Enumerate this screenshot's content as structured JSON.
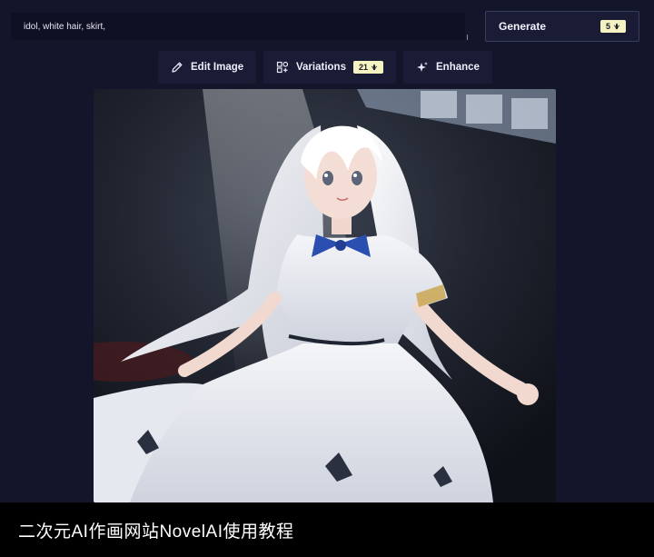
{
  "prompt": {
    "value": "idol, white hair, skirt,"
  },
  "generate": {
    "label": "Generate",
    "cost": "5",
    "cost_icon": "anlas-icon"
  },
  "toolbar": {
    "edit_label": "Edit Image",
    "edit_icon": "pencil-icon",
    "variations_label": "Variations",
    "variations_icon": "grid-icon",
    "variations_cost": "21",
    "enhance_label": "Enhance",
    "enhance_icon": "sparkle-icon"
  },
  "image": {
    "description_icon": "generated-image"
  },
  "caption": {
    "text": "二次元AI作画网站NovelAI使用教程"
  },
  "colors": {
    "background": "#13152b",
    "panel": "#1a1c36",
    "badge": "#f5f3c2"
  }
}
